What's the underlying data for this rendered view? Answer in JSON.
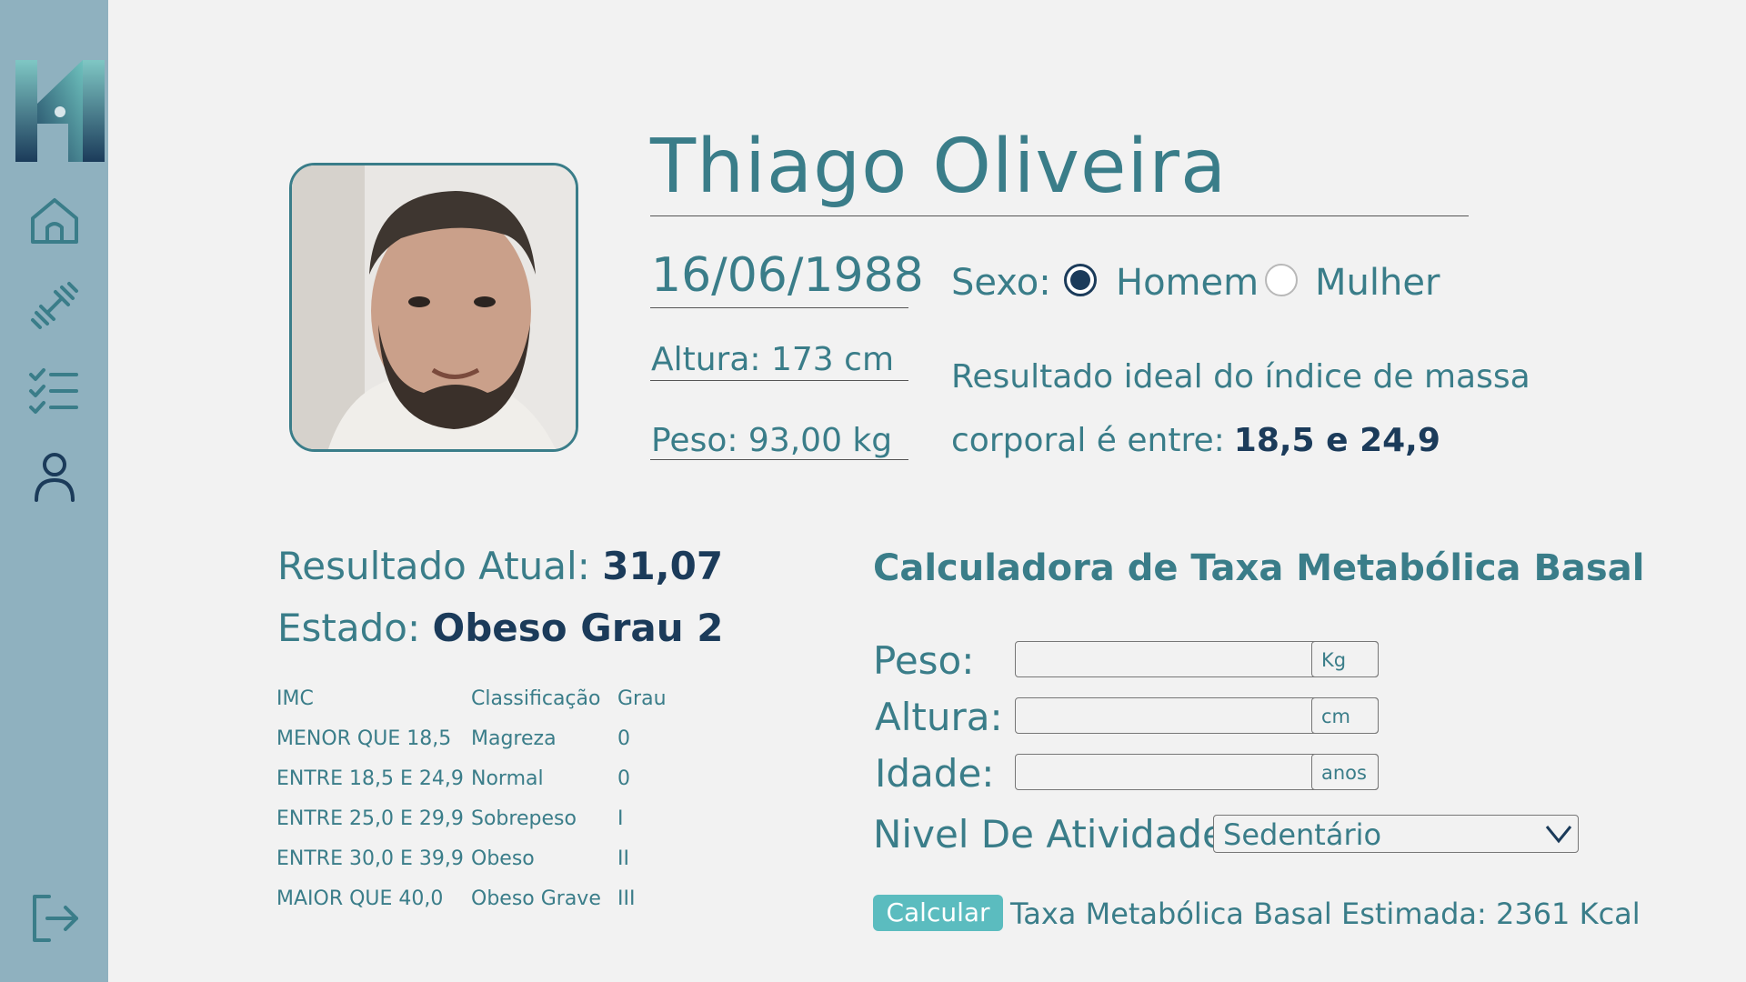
{
  "profile": {
    "name": "Thiago Oliveira",
    "birth_date": "16/06/1988",
    "sex_label": "Sexo:",
    "sex_options": [
      "Homem",
      "Mulher"
    ],
    "sex_selected": "Homem",
    "height_text": "Altura: 173 cm",
    "weight_text": "Peso: 93,00 kg",
    "ideal_line1": "Resultado ideal do índice de massa",
    "ideal_line2": "corporal é entre:",
    "ideal_value": "18,5 e 24,9"
  },
  "bmi": {
    "result_label": "Resultado Atual:",
    "result_value": "31,07",
    "state_label": "Estado:",
    "state_value": "Obeso Grau 2",
    "table": {
      "headers": [
        "IMC",
        "Classificação",
        "Grau"
      ],
      "rows": [
        [
          "MENOR QUE 18,5",
          "Magreza",
          "0"
        ],
        [
          "ENTRE 18,5 E 24,9",
          "Normal",
          "0"
        ],
        [
          "ENTRE 25,0 E 29,9",
          "Sobrepeso",
          "I"
        ],
        [
          "ENTRE 30,0 E 39,9",
          "Obeso",
          "II"
        ],
        [
          "MAIOR QUE 40,0",
          "Obeso Grave",
          "III"
        ]
      ]
    }
  },
  "calculator": {
    "title": "Calculadora de Taxa Metabólica Basal",
    "weight_label": "Peso:",
    "weight_unit": "Kg",
    "weight_value": "",
    "height_label": "Altura:",
    "height_unit": "cm",
    "height_value": "",
    "age_label": "Idade:",
    "age_unit": "anos",
    "age_value": "",
    "activity_label": "Nivel De Atividade :",
    "activity_selected": "Sedentário",
    "button_label": "Calcular",
    "result_text": "Taxa Metabólica Basal Estimada: 2361 Kcal"
  },
  "sidebar": {
    "icons": [
      "home-icon",
      "dumbbell-icon",
      "checklist-icon",
      "user-icon",
      "logout-icon"
    ]
  },
  "colors": {
    "sidebar": "#8fb1bf",
    "accent": "#3a7d89",
    "dark": "#1b3b5a",
    "button": "#5bbcbf",
    "background": "#f2f2f2"
  }
}
